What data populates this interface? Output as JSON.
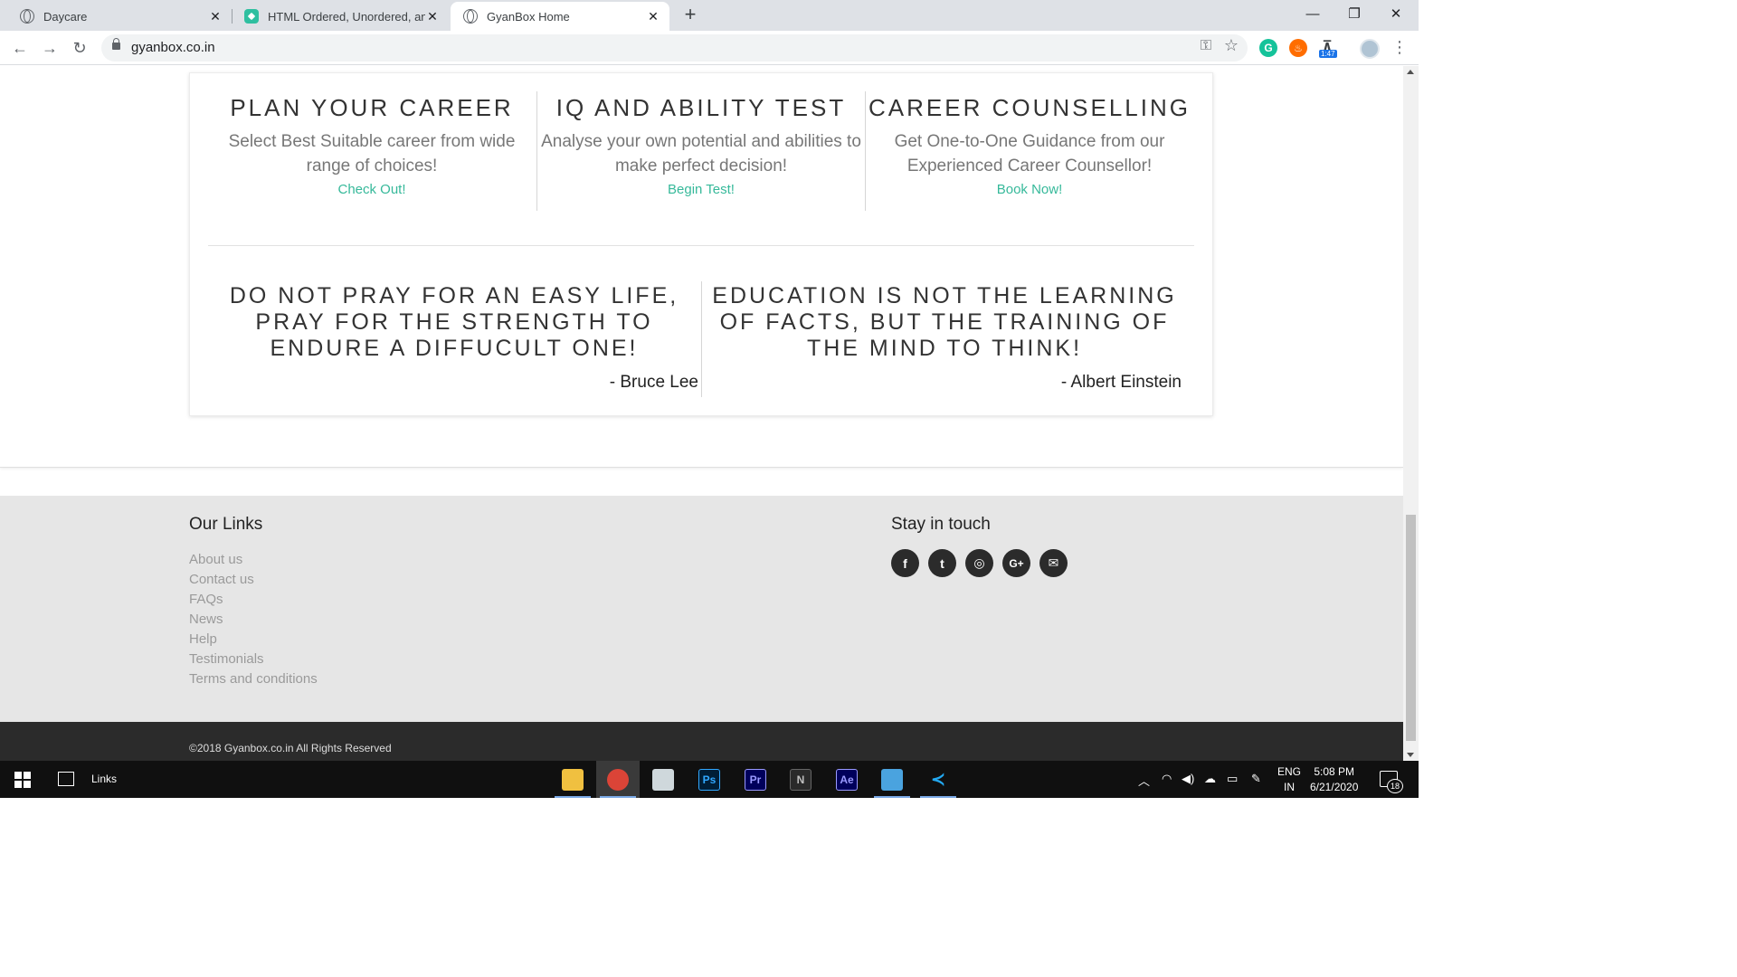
{
  "browser": {
    "tabs": [
      {
        "title": "Daycare",
        "icon": "globe-icon"
      },
      {
        "title": "HTML Ordered, Unordered, and D",
        "icon": "site-hexagon-icon"
      },
      {
        "title": "GyanBox Home",
        "icon": "globe-icon",
        "active": true
      }
    ],
    "new_tab": "+",
    "window_controls": {
      "minimize": "—",
      "maximize": "❐",
      "close": "✕"
    },
    "nav": {
      "back": "←",
      "forward": "→",
      "reload": "↻"
    },
    "url": "gyanbox.co.in",
    "extension_badge": "1:47"
  },
  "features": [
    {
      "title": "PLAN YOUR CAREER",
      "desc": "Select Best Suitable career from wide range of choices!",
      "link": "Check Out!"
    },
    {
      "title": "IQ AND ABILITY TEST",
      "desc": "Analyse your own potential and abilities to make perfect decision!",
      "link": "Begin Test!"
    },
    {
      "title": "CAREER COUNSELLING",
      "desc": "Get One-to-One Guidance from our Experienced Career Counsellor!",
      "link": "Book Now!"
    }
  ],
  "quotes": [
    {
      "text": "DO NOT PRAY FOR AN EASY LIFE, PRAY FOR THE STRENGTH TO ENDURE A DIFFUCULT ONE!",
      "author": "- Bruce Lee"
    },
    {
      "text": "EDUCATION IS NOT THE LEARNING OF FACTS, BUT THE TRAINING OF THE MIND TO THINK!",
      "author": "- Albert Einstein"
    }
  ],
  "footer": {
    "links_heading": "Our Links",
    "links": [
      "About us",
      "Contact us",
      "FAQs",
      "News",
      "Help",
      "Testimonials",
      "Terms and conditions"
    ],
    "social_heading": "Stay in touch",
    "social": [
      {
        "icon": "facebook-icon",
        "glyph": "f"
      },
      {
        "icon": "twitter-icon",
        "glyph": "t"
      },
      {
        "icon": "instagram-icon",
        "glyph": "◎"
      },
      {
        "icon": "google-plus-icon",
        "glyph": "G+"
      },
      {
        "icon": "email-icon",
        "glyph": "✉"
      }
    ],
    "copyright": "©2018 Gyanbox.co.in All Rights Reserved"
  },
  "taskbar": {
    "toolbar_label": "Links",
    "language": {
      "line1": "ENG",
      "line2": "IN"
    },
    "time": "5:08 PM",
    "date": "6/21/2020",
    "notification_count": "18",
    "apps": [
      {
        "name": "file-explorer-icon",
        "label": "",
        "color": "#f0c040"
      },
      {
        "name": "chrome-icon",
        "label": "",
        "color": "#db4437"
      },
      {
        "name": "printer-icon",
        "label": "",
        "color": "#cfd8dc"
      },
      {
        "name": "photoshop-icon",
        "label": "Ps",
        "color": "#31a8ff"
      },
      {
        "name": "premiere-icon",
        "label": "Pr",
        "color": "#9999ff"
      },
      {
        "name": "app-icon",
        "label": "N",
        "color": "#c0c0c0"
      },
      {
        "name": "after-effects-icon",
        "label": "Ae",
        "color": "#9999ff"
      },
      {
        "name": "photos-icon",
        "label": "",
        "color": "#4aa3df"
      },
      {
        "name": "vscode-icon",
        "label": "",
        "color": "#23a9f2"
      }
    ]
  },
  "colors": {
    "accent": "#36b99a",
    "footer_bg": "#e6e6e6",
    "copyright_bg": "#2b2b2b"
  }
}
